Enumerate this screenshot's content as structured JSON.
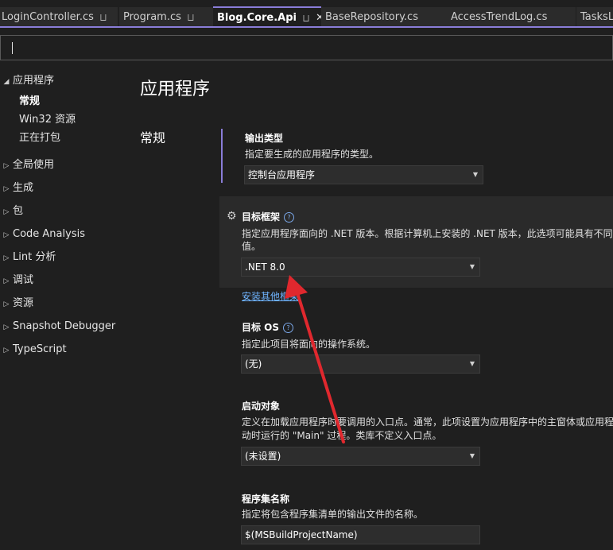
{
  "tabs": [
    {
      "label": "LoginController.cs",
      "pinned": true
    },
    {
      "label": "Program.cs",
      "pinned": true
    },
    {
      "label": "Blog.Core.Api",
      "active": true,
      "pinned": true
    },
    {
      "label": "BaseRepository.cs"
    },
    {
      "label": "AccessTrendLog.cs"
    },
    {
      "label": "TasksLo"
    }
  ],
  "icons": {
    "pin": "pin-icon",
    "close": "close-icon",
    "settings": "gear-icon",
    "help": "help-icon"
  },
  "colors": {
    "accent": "#8a7dd8",
    "link": "#6fb4ff",
    "annotation": "#e0282e"
  },
  "nav": {
    "app": {
      "label": "应用程序",
      "children": [
        "常规",
        "Win32 资源",
        "正在打包"
      ],
      "selected": "常规"
    },
    "items": [
      "全局使用",
      "生成",
      "包",
      "Code Analysis",
      "Lint 分析",
      "调试",
      "资源",
      "Snapshot Debugger",
      "TypeScript"
    ]
  },
  "page": {
    "title": "应用程序",
    "section": "常规"
  },
  "settings": {
    "output_type": {
      "label": "输出类型",
      "desc": "指定要生成的应用程序的类型。",
      "value": "控制台应用程序"
    },
    "target_framework": {
      "label": "目标框架",
      "desc_line1": "指定应用程序面向的 .NET 版本。根据计算机上安装的 .NET 版本，此选项可能具有不同",
      "desc_line2": "值。",
      "value": ".NET 8.0",
      "link": "安装其他框架"
    },
    "target_os": {
      "label": "目标 OS",
      "desc": "指定此项目将面向的操作系统。",
      "value": "(无)"
    },
    "startup_object": {
      "label": "启动对象",
      "desc_line1": "定义在加载应用程序时要调用的入口点。通常，此项设置为应用程序中的主窗体或应用程",
      "desc_line2": "动时运行的 \"Main\" 过程。类库不定义入口点。",
      "value": "(未设置)"
    },
    "assembly_name": {
      "label": "程序集名称",
      "desc": "指定将包含程序集清单的输出文件的名称。",
      "value": "$(MSBuildProjectName)"
    }
  }
}
